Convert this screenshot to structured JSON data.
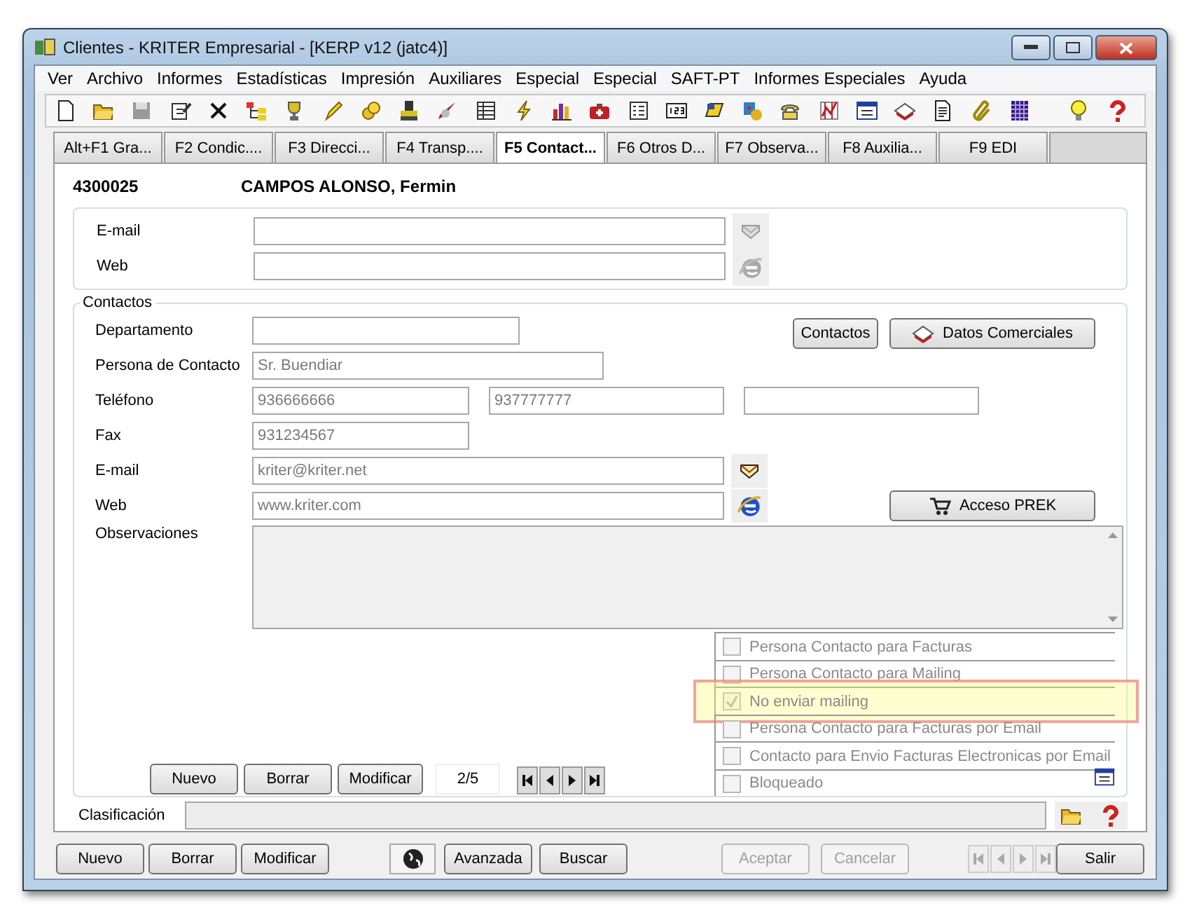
{
  "window": {
    "title": "Clientes - KRITER Empresarial - [KERP v12 (jatc4)]"
  },
  "menu": [
    "Ver",
    "Archivo",
    "Informes",
    "Estadísticas",
    "Impresión",
    "Auxiliares",
    "Especial",
    "Especial",
    "SAFT-PT",
    "Informes Especiales",
    "Ayuda"
  ],
  "tabs": [
    {
      "label": "Alt+F1 Gra...",
      "selected": false
    },
    {
      "label": "F2 Condic....",
      "selected": false
    },
    {
      "label": "F3 Direcci...",
      "selected": false
    },
    {
      "label": "F4 Transp....",
      "selected": false
    },
    {
      "label": "F5 Contact...",
      "selected": true
    },
    {
      "label": "F6 Otros D...",
      "selected": false
    },
    {
      "label": "F7 Observa...",
      "selected": false
    },
    {
      "label": "F8 Auxilia...",
      "selected": false
    },
    {
      "label": "F9 EDI",
      "selected": false
    }
  ],
  "record": {
    "code": "4300025",
    "name": "CAMPOS ALONSO, Fermin"
  },
  "client_links": {
    "action_enabled": false,
    "fields": [
      {
        "label": "E-mail",
        "kind": "email"
      },
      {
        "label": "Web",
        "kind": "web"
      }
    ]
  },
  "contactos": {
    "title": "Contactos",
    "departamento": {
      "label": "Departamento"
    },
    "persona": {
      "label": "Persona de Contacto",
      "value": "Sr. Buendiar"
    },
    "telefono": {
      "label": "Teléfono",
      "fields": [
        {
          "value": "936666666"
        },
        {
          "value": "937777777"
        }
      ]
    },
    "fax": {
      "label": "Fax",
      "value": "931234567"
    },
    "links": {
      "action_enabled": true,
      "fields": [
        {
          "label": "E-mail",
          "kind": "email",
          "value": "kriter@kriter.net"
        },
        {
          "label": "Web",
          "kind": "web",
          "value": "www.kriter.com"
        }
      ]
    },
    "buttons": [
      {
        "label": "Contactos",
        "kind": "plain"
      },
      {
        "label": "Datos Comerciales",
        "kind": "book"
      }
    ],
    "prek_button": {
      "label": "Acceso PREK"
    },
    "observaciones": {
      "label": "Observaciones"
    },
    "record_buttons": [
      "Nuevo",
      "Borrar",
      "Modificar"
    ],
    "position": "2/5",
    "flags": [
      {
        "label": "Persona Contacto para Facturas",
        "checked": false,
        "highlighted": false
      },
      {
        "label": "Persona Contacto para Mailing",
        "checked": false,
        "highlighted": false
      },
      {
        "label": "No enviar mailing",
        "checked": true,
        "highlighted": true
      },
      {
        "label": "Persona Contacto para Facturas por Email",
        "checked": false,
        "highlighted": false
      },
      {
        "label": "Contacto para Envio Facturas Electronicas por Email",
        "checked": false,
        "highlighted": false
      },
      {
        "label": "Bloqueado",
        "checked": false,
        "highlighted": false
      }
    ]
  },
  "clasificacion": {
    "label": "Clasificación"
  },
  "footer": {
    "left": [
      {
        "label": "Nuevo",
        "disabled": false
      },
      {
        "label": "Borrar",
        "disabled": false
      },
      {
        "label": "Modificar",
        "disabled": false
      }
    ],
    "middle": [
      {
        "label": "Avanzada",
        "disabled": false
      },
      {
        "label": "Buscar",
        "disabled": false
      }
    ],
    "right": [
      {
        "label": "Aceptar",
        "disabled": true
      },
      {
        "label": "Cancelar",
        "disabled": true
      }
    ],
    "navigation": {
      "disabled": true
    },
    "exit": {
      "label": "Salir",
      "disabled": false
    }
  }
}
